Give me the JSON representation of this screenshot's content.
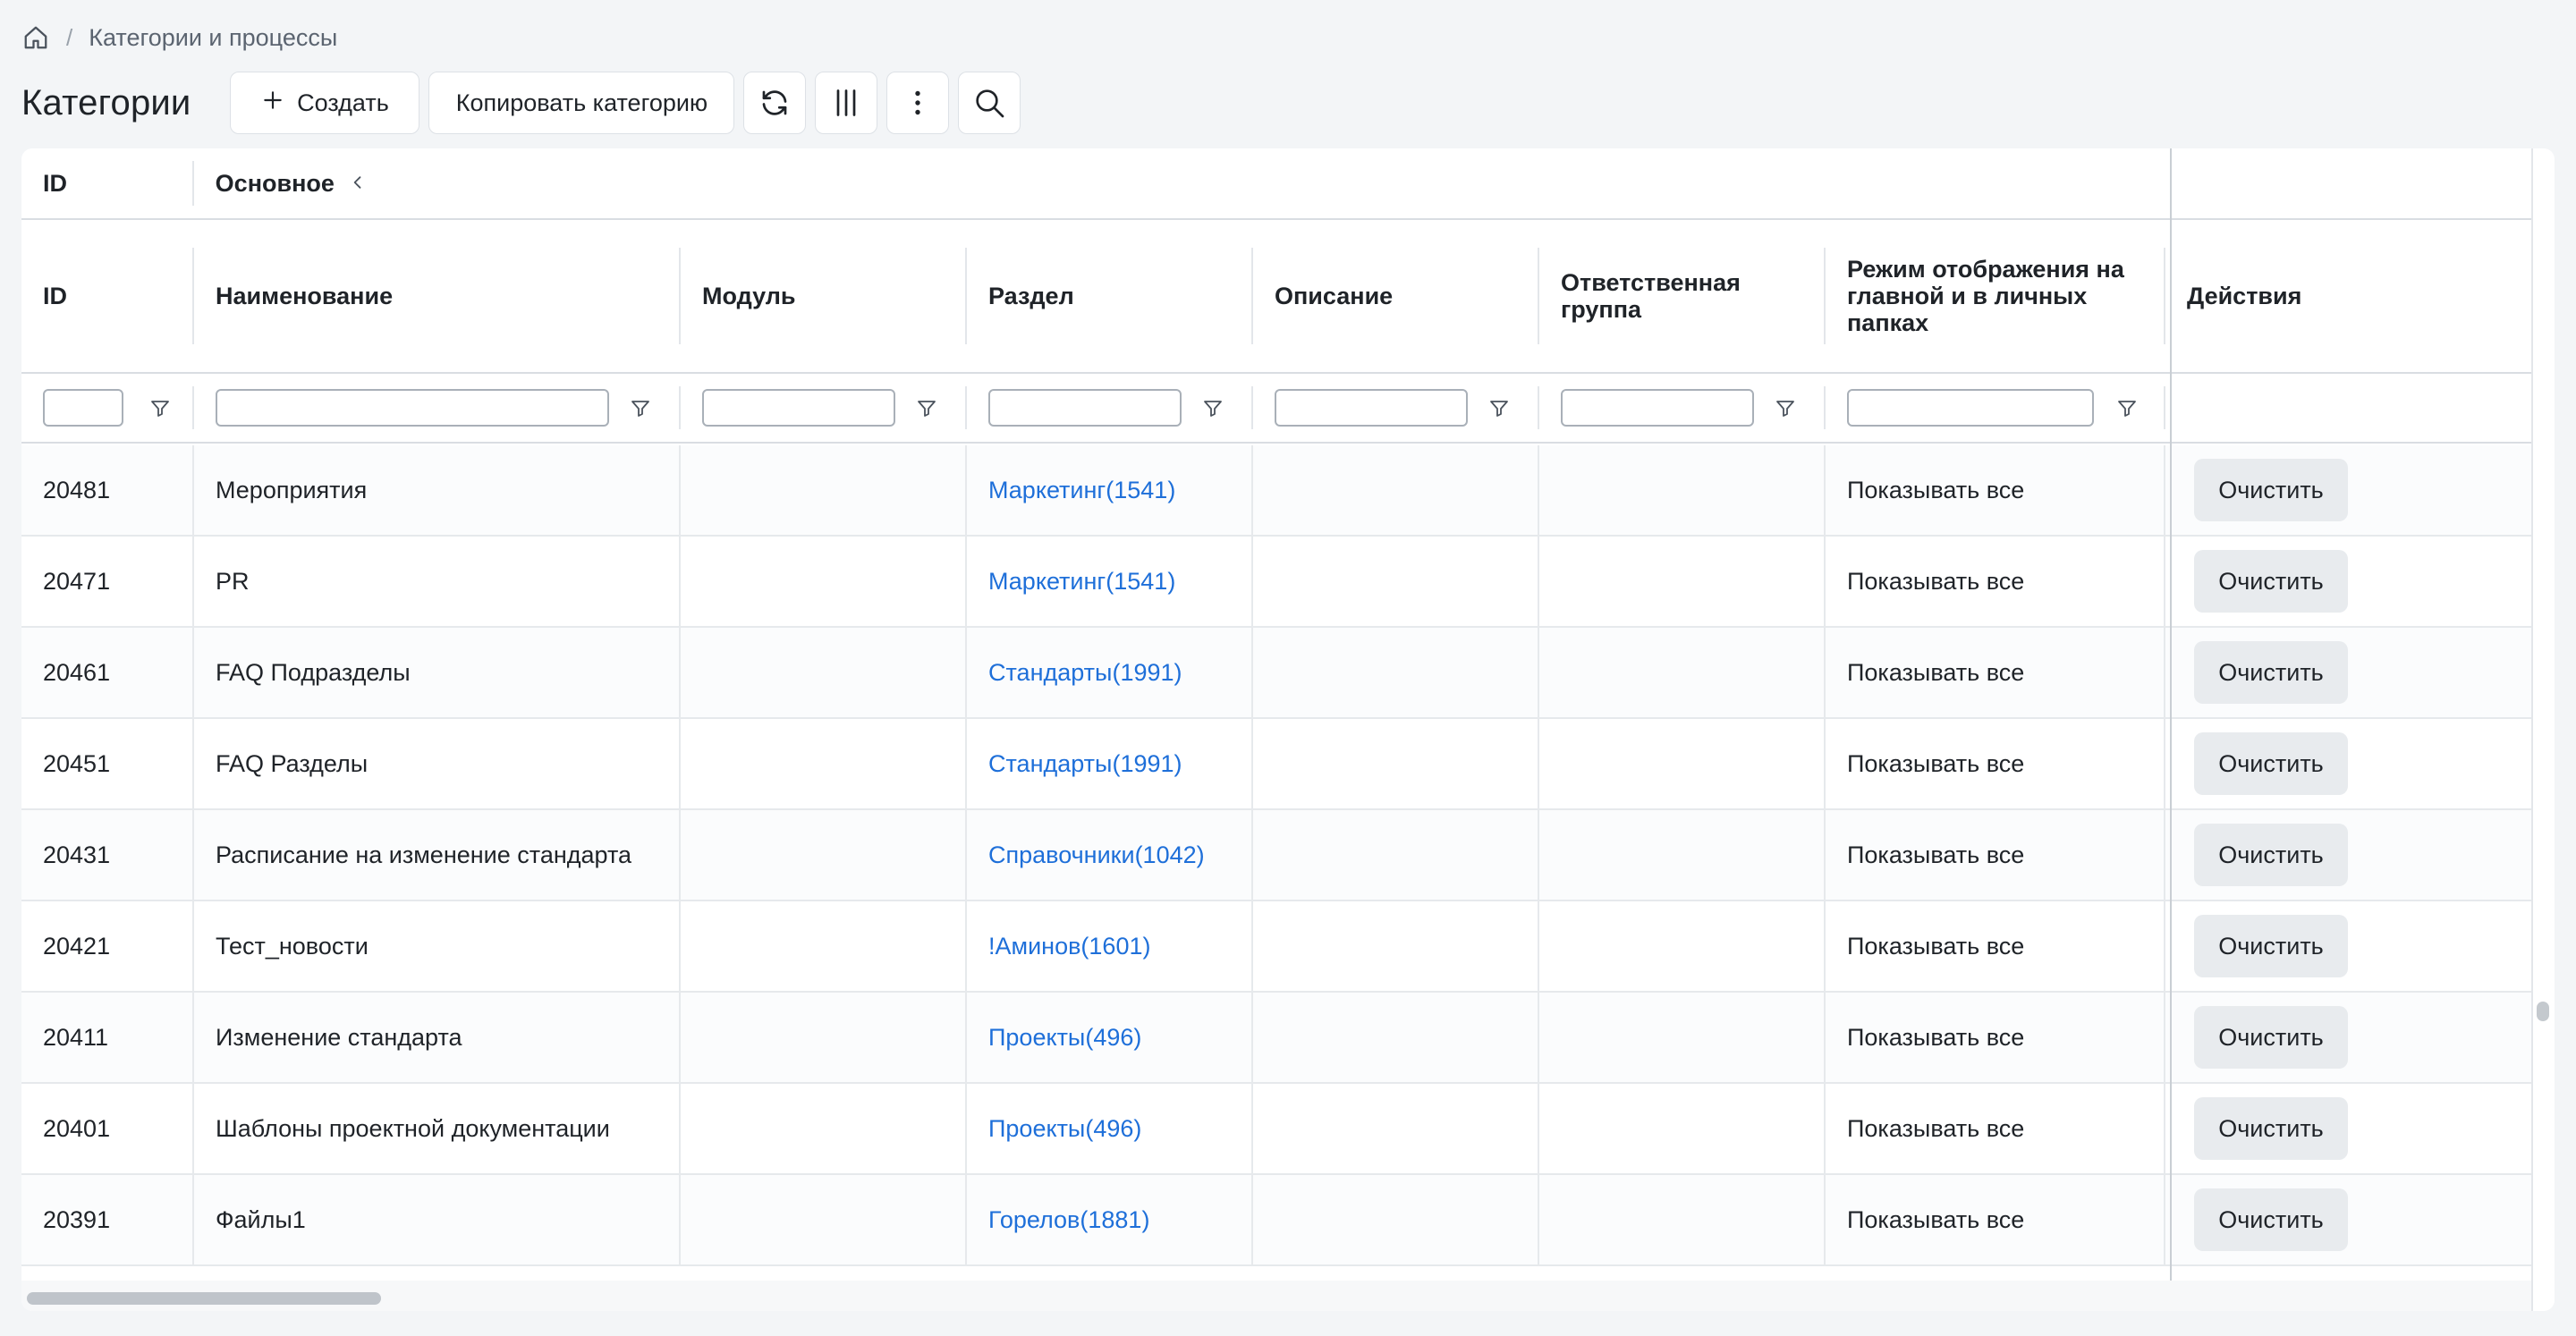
{
  "breadcrumb": {
    "separator": "/",
    "current": "Категории и процессы"
  },
  "toolbar": {
    "title": "Категории",
    "create_label": "Создать",
    "copy_label": "Копировать категорию",
    "icons": [
      "plus-icon",
      "refresh-icon",
      "columns-icon",
      "more-vertical-icon",
      "search-icon"
    ]
  },
  "table": {
    "group_row": {
      "id": "ID",
      "basic": "Основное"
    },
    "columns": {
      "id": "ID",
      "name": "Наименование",
      "module": "Модуль",
      "section": "Раздел",
      "description": "Описание",
      "group": "Ответственная группа",
      "mode": "Режим отображения на главной и в личных папках",
      "actions": "Действия"
    },
    "rows": [
      {
        "id": "20481",
        "name": "Мероприятия",
        "module": "",
        "section": "Маркетинг(1541)",
        "description": "",
        "group": "",
        "mode": "Показывать все",
        "action": "Очистить"
      },
      {
        "id": "20471",
        "name": "PR",
        "module": "",
        "section": "Маркетинг(1541)",
        "description": "",
        "group": "",
        "mode": "Показывать все",
        "action": "Очистить"
      },
      {
        "id": "20461",
        "name": "FAQ Подразделы",
        "module": "",
        "section": "Стандарты(1991)",
        "description": "",
        "group": "",
        "mode": "Показывать все",
        "action": "Очистить"
      },
      {
        "id": "20451",
        "name": "FAQ Разделы",
        "module": "",
        "section": "Стандарты(1991)",
        "description": "",
        "group": "",
        "mode": "Показывать все",
        "action": "Очистить"
      },
      {
        "id": "20431",
        "name": "Расписание на изменение стандарта",
        "module": "",
        "section": "Справочники(1042)",
        "description": "",
        "group": "",
        "mode": "Показывать все",
        "action": "Очистить"
      },
      {
        "id": "20421",
        "name": "Тест_новости",
        "module": "",
        "section": "!Аминов(1601)",
        "description": "",
        "group": "",
        "mode": "Показывать все",
        "action": "Очистить"
      },
      {
        "id": "20411",
        "name": "Изменение стандарта",
        "module": "",
        "section": "Проекты(496)",
        "description": "",
        "group": "",
        "mode": "Показывать все",
        "action": "Очистить"
      },
      {
        "id": "20401",
        "name": "Шаблоны проектной документации",
        "module": "",
        "section": "Проекты(496)",
        "description": "",
        "group": "",
        "mode": "Показывать все",
        "action": "Очистить"
      },
      {
        "id": "20391",
        "name": "Файлы1",
        "module": "",
        "section": "Горелов(1881)",
        "description": "",
        "group": "",
        "mode": "Показывать все",
        "action": "Очистить"
      }
    ]
  },
  "colors": {
    "link": "#1e6fd9",
    "page_bg": "#f3f5f7",
    "button_bg": "#e8ebee"
  }
}
